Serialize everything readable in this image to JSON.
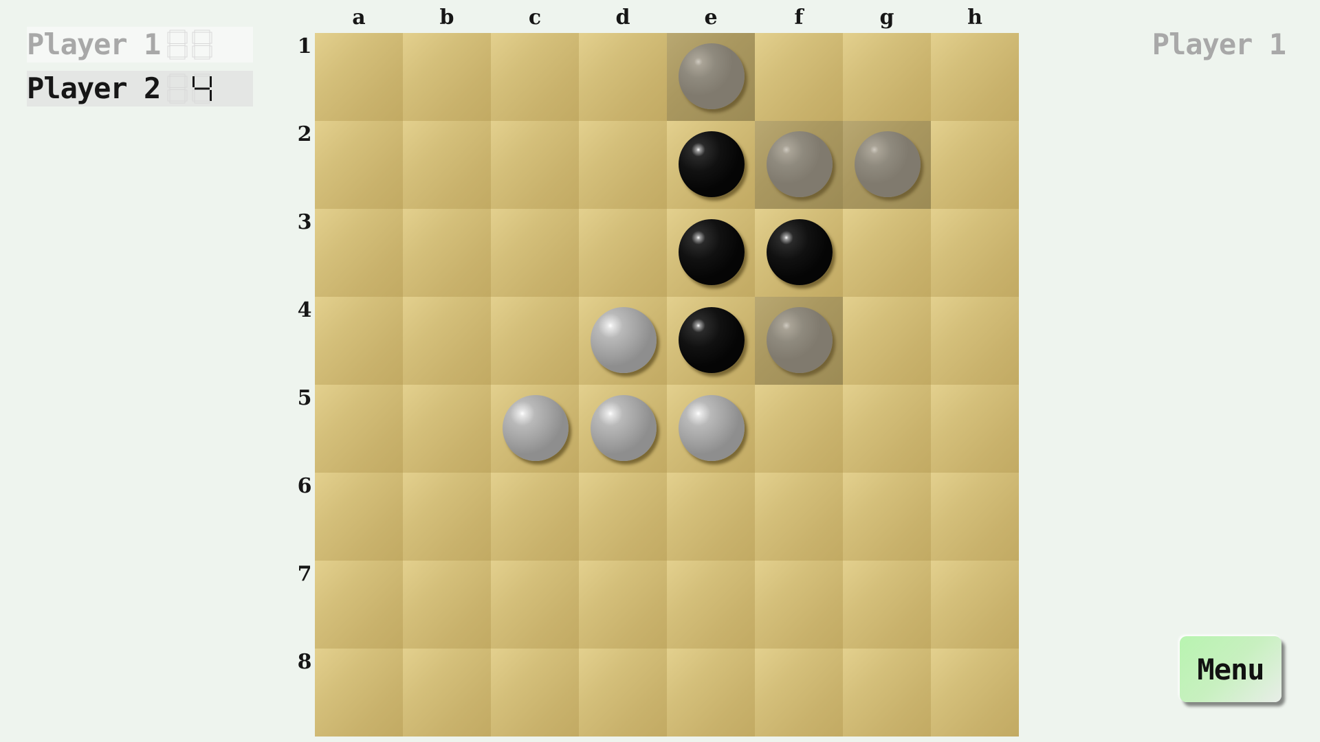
{
  "scoreboard": {
    "players": [
      {
        "name": "Player 1",
        "score": "",
        "active": false
      },
      {
        "name": "Player 2",
        "score": "4",
        "active": true
      }
    ]
  },
  "turn_label": "Player 1",
  "menu_label": "Menu",
  "board": {
    "columns": [
      "a",
      "b",
      "c",
      "d",
      "e",
      "f",
      "g",
      "h"
    ],
    "rows": [
      "1",
      "2",
      "3",
      "4",
      "5",
      "6",
      "7",
      "8"
    ],
    "stones": [
      {
        "cell": "e2",
        "color": "black"
      },
      {
        "cell": "e3",
        "color": "black"
      },
      {
        "cell": "f3",
        "color": "black"
      },
      {
        "cell": "e4",
        "color": "black"
      },
      {
        "cell": "d4",
        "color": "white"
      },
      {
        "cell": "c5",
        "color": "white"
      },
      {
        "cell": "d5",
        "color": "white"
      },
      {
        "cell": "e5",
        "color": "white"
      }
    ],
    "hints": [
      "e1",
      "f2",
      "g2",
      "f4"
    ]
  },
  "colors": {
    "background": "#eef4ee",
    "board_light": "#e3d08e",
    "board_dark": "#c2aa63",
    "hint_cell": "#aa9860",
    "menu_green": "#b8f4b0"
  }
}
